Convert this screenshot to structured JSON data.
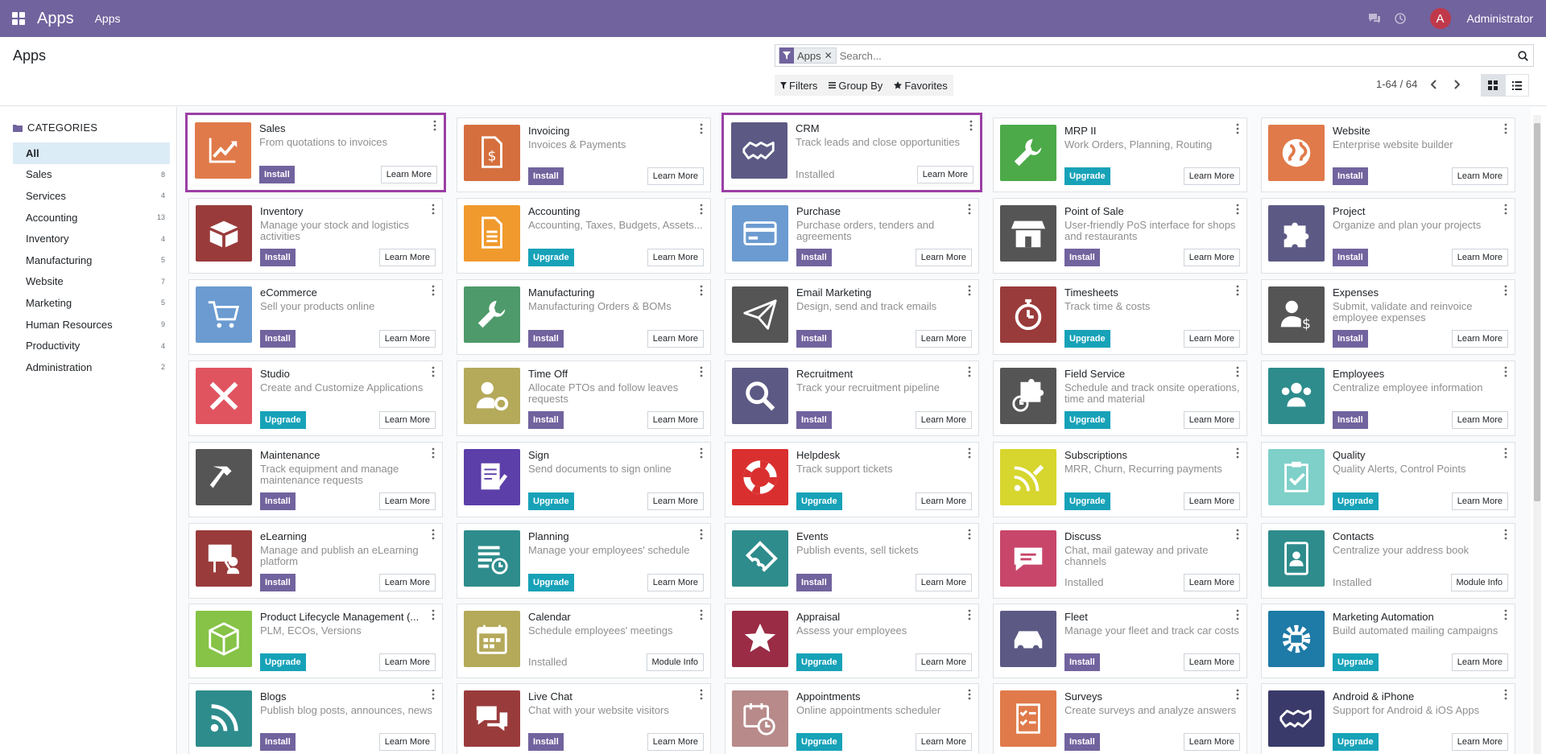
{
  "navbar": {
    "brand": "Apps",
    "menu": "Apps",
    "user_initial": "A",
    "user_name": "Administrator"
  },
  "control": {
    "title": "Apps",
    "facet_value": "Apps",
    "search_placeholder": "Search...",
    "filters_label": "Filters",
    "groupby_label": "Group By",
    "favorites_label": "Favorites",
    "pager": "1-64 / 64"
  },
  "sidebar": {
    "header": "CATEGORIES",
    "items": [
      {
        "label": "All",
        "count": ""
      },
      {
        "label": "Sales",
        "count": "8"
      },
      {
        "label": "Services",
        "count": "4"
      },
      {
        "label": "Accounting",
        "count": "13"
      },
      {
        "label": "Inventory",
        "count": "4"
      },
      {
        "label": "Manufacturing",
        "count": "5"
      },
      {
        "label": "Website",
        "count": "7"
      },
      {
        "label": "Marketing",
        "count": "5"
      },
      {
        "label": "Human Resources",
        "count": "9"
      },
      {
        "label": "Productivity",
        "count": "4"
      },
      {
        "label": "Administration",
        "count": "2"
      }
    ]
  },
  "apps": [
    {
      "name": "Sales",
      "summary": "From quotations to invoices",
      "action": "Install",
      "info": "Learn More",
      "color": "#e07a4a",
      "icon": "chart-up-icon",
      "highlight": true
    },
    {
      "name": "Invoicing",
      "summary": "Invoices & Payments",
      "action": "Install",
      "info": "Learn More",
      "color": "#d56f3e",
      "icon": "invoice-icon"
    },
    {
      "name": "CRM",
      "summary": "Track leads and close opportunities",
      "action": "Installed",
      "info": "Learn More",
      "color": "#5c5a84",
      "icon": "handshake-icon",
      "highlight": true
    },
    {
      "name": "MRP II",
      "summary": "Work Orders, Planning, Routing",
      "action": "Upgrade",
      "info": "Learn More",
      "color": "#4caa48",
      "icon": "wrench-icon"
    },
    {
      "name": "Website",
      "summary": "Enterprise website builder",
      "action": "Install",
      "info": "Learn More",
      "color": "#e07a4a",
      "icon": "globe-icon"
    },
    {
      "name": "Inventory",
      "summary": "Manage your stock and logistics activities",
      "action": "Install",
      "info": "Learn More",
      "color": "#9a3b3b",
      "icon": "box-icon"
    },
    {
      "name": "Accounting",
      "summary": "Accounting, Taxes, Budgets, Assets...",
      "action": "Upgrade",
      "info": "Learn More",
      "color": "#f09a2e",
      "icon": "document-icon"
    },
    {
      "name": "Purchase",
      "summary": "Purchase orders, tenders and agreements",
      "action": "Install",
      "info": "Learn More",
      "color": "#6b9bd0",
      "icon": "credit-card-icon"
    },
    {
      "name": "Point of Sale",
      "summary": "User-friendly PoS interface for shops and restaurants",
      "action": "Install",
      "info": "Learn More",
      "color": "#555555",
      "icon": "shop-icon"
    },
    {
      "name": "Project",
      "summary": "Organize and plan your projects",
      "action": "Install",
      "info": "Learn More",
      "color": "#5c5a84",
      "icon": "puzzle-icon"
    },
    {
      "name": "eCommerce",
      "summary": "Sell your products online",
      "action": "Install",
      "info": "Learn More",
      "color": "#6b9bd0",
      "icon": "cart-icon"
    },
    {
      "name": "Manufacturing",
      "summary": "Manufacturing Orders & BOMs",
      "action": "Install",
      "info": "Learn More",
      "color": "#4e9a6a",
      "icon": "wrench-icon"
    },
    {
      "name": "Email Marketing",
      "summary": "Design, send and track emails",
      "action": "Install",
      "info": "Learn More",
      "color": "#555555",
      "icon": "paper-plane-icon"
    },
    {
      "name": "Timesheets",
      "summary": "Track time & costs",
      "action": "Upgrade",
      "info": "Learn More",
      "color": "#9a3b3b",
      "icon": "stopwatch-icon"
    },
    {
      "name": "Expenses",
      "summary": "Submit, validate and reinvoice employee expenses",
      "action": "Install",
      "info": "Learn More",
      "color": "#555555",
      "icon": "user-dollar-icon"
    },
    {
      "name": "Studio",
      "summary": "Create and Customize Applications",
      "action": "Upgrade",
      "info": "Learn More",
      "color": "#e05460",
      "icon": "tools-icon"
    },
    {
      "name": "Time Off",
      "summary": "Allocate PTOs and follow leaves requests",
      "action": "Install",
      "info": "Learn More",
      "color": "#b5a95a",
      "icon": "user-gear-icon"
    },
    {
      "name": "Recruitment",
      "summary": "Track your recruitment pipeline",
      "action": "Install",
      "info": "Learn More",
      "color": "#5c5a84",
      "icon": "magnifier-icon"
    },
    {
      "name": "Field Service",
      "summary": "Schedule and track onsite operations, time and material",
      "action": "Upgrade",
      "info": "Learn More",
      "color": "#555555",
      "icon": "puzzle-clock-icon"
    },
    {
      "name": "Employees",
      "summary": "Centralize employee information",
      "action": "Install",
      "info": "Learn More",
      "color": "#2e8c8c",
      "icon": "users-icon"
    },
    {
      "name": "Maintenance",
      "summary": "Track equipment and manage maintenance requests",
      "action": "Install",
      "info": "Learn More",
      "color": "#555555",
      "icon": "hammer-icon"
    },
    {
      "name": "Sign",
      "summary": "Send documents to sign online",
      "action": "Upgrade",
      "info": "Learn More",
      "color": "#5c3fa8",
      "icon": "sign-icon"
    },
    {
      "name": "Helpdesk",
      "summary": "Track support tickets",
      "action": "Upgrade",
      "info": "Learn More",
      "color": "#d9302f",
      "icon": "lifebuoy-icon"
    },
    {
      "name": "Subscriptions",
      "summary": "MRR, Churn, Recurring payments",
      "action": "Upgrade",
      "info": "Learn More",
      "color": "#d6d62e",
      "icon": "rss-pencil-icon"
    },
    {
      "name": "Quality",
      "summary": "Quality Alerts, Control Points",
      "action": "Upgrade",
      "info": "Learn More",
      "color": "#7ed0c9",
      "icon": "clipboard-check-icon"
    },
    {
      "name": "eLearning",
      "summary": "Manage and publish an eLearning platform",
      "action": "Install",
      "info": "Learn More",
      "color": "#9a3b3b",
      "icon": "presentation-icon"
    },
    {
      "name": "Planning",
      "summary": "Manage your employees' schedule",
      "action": "Upgrade",
      "info": "Learn More",
      "color": "#2e8c8c",
      "icon": "list-clock-icon"
    },
    {
      "name": "Events",
      "summary": "Publish events, sell tickets",
      "action": "Install",
      "info": "Learn More",
      "color": "#2e8c8c",
      "icon": "ticket-icon"
    },
    {
      "name": "Discuss",
      "summary": "Chat, mail gateway and private channels",
      "action": "Installed",
      "info": "Learn More",
      "color": "#c8466a",
      "icon": "chat-icon"
    },
    {
      "name": "Contacts",
      "summary": "Centralize your address book",
      "action": "Installed",
      "info": "Module Info",
      "color": "#2e8c8c",
      "icon": "address-book-icon"
    },
    {
      "name": "Product Lifecycle Management (...",
      "summary": "PLM, ECOs, Versions",
      "action": "Upgrade",
      "info": "Learn More",
      "color": "#86c346",
      "icon": "cube-icon"
    },
    {
      "name": "Calendar",
      "summary": "Schedule employees' meetings",
      "action": "Installed",
      "info": "Module Info",
      "color": "#b5a95a",
      "icon": "calendar-icon"
    },
    {
      "name": "Appraisal",
      "summary": "Assess your employees",
      "action": "Upgrade",
      "info": "Learn More",
      "color": "#9a2c45",
      "icon": "star-icon"
    },
    {
      "name": "Fleet",
      "summary": "Manage your fleet and track car costs",
      "action": "Install",
      "info": "Learn More",
      "color": "#5c5a84",
      "icon": "car-icon"
    },
    {
      "name": "Marketing Automation",
      "summary": "Build automated mailing campaigns",
      "action": "Upgrade",
      "info": "Learn More",
      "color": "#1e7aa6",
      "icon": "gear-mail-icon"
    },
    {
      "name": "Blogs",
      "summary": "Publish blog posts, announces, news",
      "action": "Install",
      "info": "Learn More",
      "color": "#2e8c8c",
      "icon": "rss-icon"
    },
    {
      "name": "Live Chat",
      "summary": "Chat with your website visitors",
      "action": "Install",
      "info": "Learn More",
      "color": "#9a3b3b",
      "icon": "chat-bubbles-icon"
    },
    {
      "name": "Appointments",
      "summary": "Online appointments scheduler",
      "action": "Upgrade",
      "info": "Learn More",
      "color": "#b88a8a",
      "icon": "calendar-clock-icon"
    },
    {
      "name": "Surveys",
      "summary": "Create surveys and analyze answers",
      "action": "Install",
      "info": "Learn More",
      "color": "#e07a4a",
      "icon": "checklist-icon"
    },
    {
      "name": "Android & iPhone",
      "summary": "Support for Android & iOS Apps",
      "action": "Upgrade",
      "info": "Learn More",
      "color": "#3a3a6a",
      "icon": "handshake-icon"
    }
  ]
}
